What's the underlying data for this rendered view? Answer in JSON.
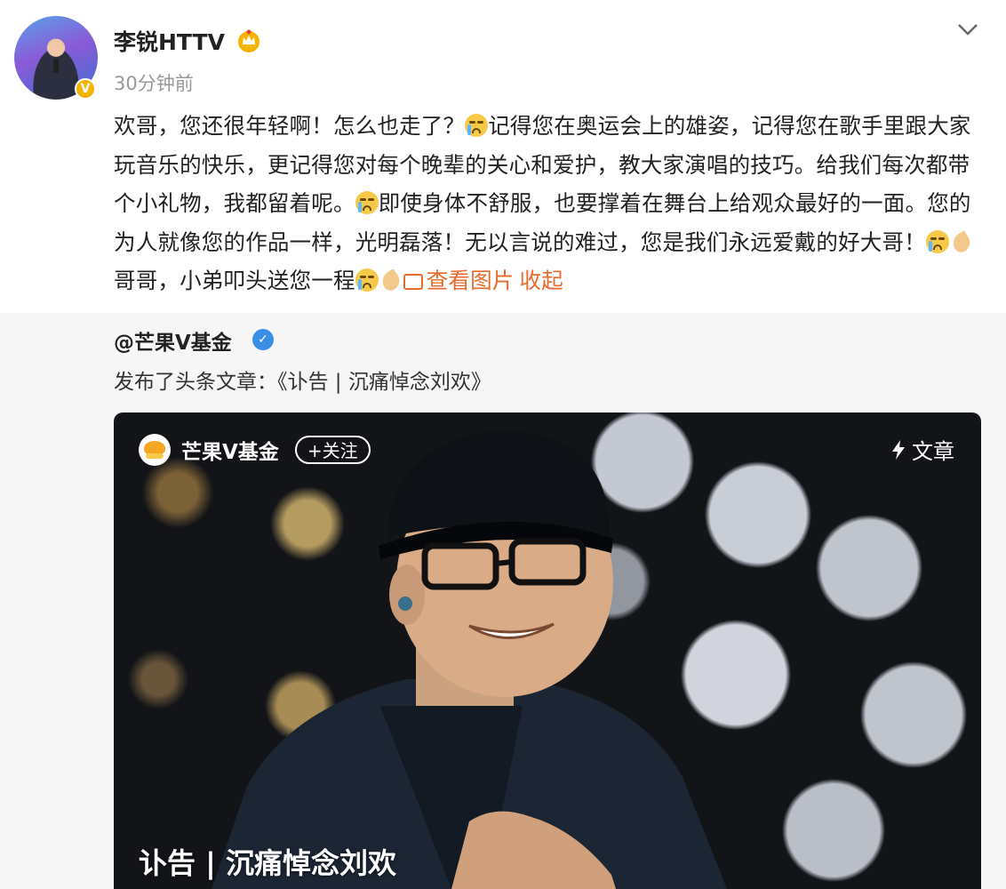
{
  "post": {
    "username": "李锐HTTV",
    "time": "30分钟前",
    "content": {
      "p1": "欢哥，您还很年轻啊！怎么也走了？",
      "p2": "记得您在奥运会上的雄姿，记得您在歌手里跟大家玩音乐的快乐，更记得您对每个晚辈的关心和爱护，教大家演唱的技巧。给我们每次都带个小礼物，我都留着呢。",
      "p3": "即使身体不舒服，也要撑着在舞台上给观众最好的一面。您的为人就像您的作品一样，光明磊落！无以言说的难过，您是我们永远爱戴的好大哥！",
      "p4": "哥哥，小弟叩头送您一程"
    },
    "view_image_label": "查看图片",
    "collapse_label": "收起",
    "verified_badge": "V"
  },
  "repost": {
    "author": "@芒果V基金",
    "text": "发布了头条文章：《讣告 | 沉痛悼念刘欢》",
    "verified_badge": "✓",
    "card": {
      "brand": "芒果V基金",
      "follow_label": "+关注",
      "type_label": "文章",
      "title": "讣告 | 沉痛悼念刘欢"
    }
  },
  "icons": {
    "emoji_cry": "crying-emoji",
    "emoji_pray": "praying-hands-emoji",
    "image_link": "image-icon",
    "chevron": "chevron-down-icon",
    "crown": "crown-badge-icon",
    "bolt": "lightning-icon"
  },
  "colors": {
    "link": "#e86a2a",
    "verified_blue": "#3a8ee6",
    "verified_gold": "#f5b400",
    "repost_bg": "#f6f6f6"
  }
}
